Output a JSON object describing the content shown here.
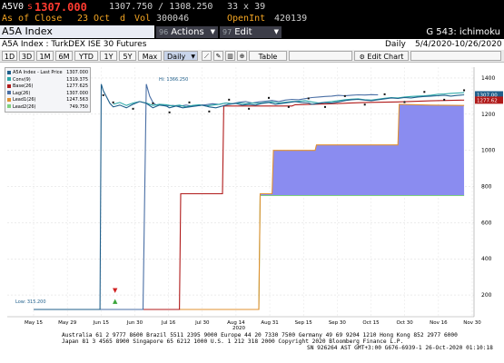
{
  "header": {
    "ticker": "A5V0",
    "last_prefix": "s",
    "last_price": "1307.000",
    "range": "1307.750 / 1308.250",
    "size": "33 x 39",
    "as_of_label": "As of Close",
    "as_of_date": "23 Oct",
    "as_of_flag": "d",
    "vol_label": "Vol",
    "vol_value": "300046",
    "openint_label": "OpenInt",
    "openint_value": "420139"
  },
  "toolbar": {
    "title": "A5A Index",
    "actions_num": "96",
    "actions_label": "Actions",
    "edit_num": "97",
    "edit_label": "Edit",
    "func_label": "G 543: ichimoku"
  },
  "subheader": {
    "security": "A5A Index : TurkDEX ISE 30 Futures",
    "period": "Daily",
    "date_range": "5/4/2020-10/26/2020"
  },
  "tabs": {
    "items": [
      "1D",
      "3D",
      "1M",
      "6M",
      "YTD",
      "1Y",
      "5Y",
      "Max"
    ],
    "frequency": "Daily",
    "table_label": "Table",
    "edit_chart_label": "Edit Chart"
  },
  "legend": {
    "items": [
      {
        "label": "A5A Index - Last Price",
        "value": "1307.000",
        "color": "#1f5f8b"
      },
      {
        "label": "Conv(9)",
        "value": "1319.375",
        "color": "#2aa7a7"
      },
      {
        "label": "Base(26)",
        "value": "1277.625",
        "color": "#b01a1a"
      },
      {
        "label": "Lag(26)",
        "value": "1307.000",
        "color": "#4a6fa5"
      },
      {
        "label": "Lead1(26)",
        "value": "1247.563",
        "color": "#e09030"
      },
      {
        "label": "Lead2(26)",
        "value": "749.750",
        "color": "#7ed07e"
      }
    ]
  },
  "annotations": {
    "high": "Hi: 1366.250",
    "low": "Low: 315.200"
  },
  "chart_data": {
    "type": "line",
    "y_ticks": [
      "1400",
      "1200",
      "1000",
      "800",
      "600",
      "400",
      "200"
    ],
    "ylim": [
      80,
      1460
    ],
    "x_ticks": [
      "May 15",
      "May 29",
      "Jun 15",
      "Jun 30",
      "Jul 16",
      "Jul 30",
      "Aug 14",
      "Aug 31",
      "Sep 15",
      "Sep 30",
      "Oct 15",
      "Oct 30",
      "Nov 16",
      "Nov 30"
    ],
    "x_axis_year": "2020",
    "last_price_tag": "1307.00",
    "base_tag": "1277.62",
    "series": [
      {
        "name": "A5A Index - Last Price",
        "color": "#1f5f8b",
        "x": [
          0,
          20,
          20.4,
          21,
          22,
          23,
          24,
          26,
          28,
          30,
          32,
          34,
          36,
          38,
          40,
          41,
          43,
          45,
          47,
          49,
          51,
          53,
          55,
          57,
          59,
          61,
          63,
          65,
          67,
          69,
          71,
          73,
          75,
          77,
          79,
          81,
          83,
          84,
          86,
          88,
          90,
          92,
          94,
          96,
          98,
          100,
          102,
          104,
          106,
          108,
          110,
          112,
          114,
          116,
          118,
          120,
          122,
          124,
          126,
          128,
          130
        ],
        "y": [
          120,
          120,
          1366,
          1330,
          1295,
          1260,
          1240,
          1250,
          1235,
          1255,
          1270,
          1260,
          1235,
          1250,
          1245,
          1235,
          1245,
          1235,
          1240,
          1245,
          1250,
          1240,
          1235,
          1245,
          1255,
          1260,
          1250,
          1255,
          1250,
          1260,
          1265,
          1255,
          1260,
          1265,
          1270,
          1265,
          1262,
          1255,
          1260,
          1265,
          1262,
          1268,
          1275,
          1280,
          1282,
          1278,
          1275,
          1280,
          1285,
          1290,
          1287,
          1292,
          1290,
          1295,
          1298,
          1300,
          1302,
          1305,
          1300,
          1304,
          1307
        ]
      },
      {
        "name": "Conv(9)",
        "color": "#2aa7a7",
        "x": [
          24,
          26,
          28,
          30,
          32,
          34,
          36,
          38,
          40,
          42,
          44,
          46,
          48,
          50,
          52,
          54,
          56,
          58,
          60,
          62,
          64,
          66,
          68,
          70,
          72,
          74,
          76,
          78,
          80,
          82,
          84,
          86,
          88,
          90,
          92,
          94,
          96,
          98,
          100,
          102,
          104,
          106,
          108,
          110,
          112,
          114,
          116,
          118,
          120,
          122,
          124,
          126,
          128,
          130
        ],
        "y": [
          1255,
          1265,
          1248,
          1262,
          1270,
          1262,
          1248,
          1255,
          1252,
          1245,
          1250,
          1240,
          1248,
          1252,
          1245,
          1250,
          1255,
          1262,
          1258,
          1262,
          1258,
          1262,
          1260,
          1265,
          1268,
          1262,
          1266,
          1270,
          1272,
          1275,
          1268,
          1262,
          1266,
          1270,
          1275,
          1280,
          1283,
          1285,
          1280,
          1278,
          1283,
          1288,
          1292,
          1290,
          1295,
          1298,
          1300,
          1302,
          1305,
          1310,
          1312,
          1315,
          1317,
          1319
        ]
      },
      {
        "name": "Base(26)",
        "color": "#b01a1a",
        "x": [
          0,
          44,
          44.4,
          57,
          57.4,
          78,
          79,
          90,
          100,
          110,
          120,
          130
        ],
        "y": [
          120,
          120,
          760,
          760,
          1245,
          1245,
          1252,
          1258,
          1265,
          1268,
          1274,
          1278
        ]
      },
      {
        "name": "Lag(26)",
        "color": "#4a6fa5",
        "x": [
          0,
          33,
          34,
          35,
          36,
          37,
          38,
          40,
          42,
          44,
          46,
          48,
          50,
          52,
          54,
          56,
          58,
          60,
          62,
          64,
          66,
          68,
          70,
          72,
          74,
          76,
          78,
          80,
          82,
          84,
          86,
          88,
          90,
          92,
          94,
          96,
          98,
          100,
          102,
          104
        ],
        "y": [
          120,
          120,
          1366,
          1300,
          1265,
          1250,
          1255,
          1245,
          1248,
          1244,
          1250,
          1244,
          1248,
          1252,
          1258,
          1254,
          1262,
          1258,
          1266,
          1270,
          1262,
          1268,
          1272,
          1276,
          1270,
          1278,
          1282,
          1280,
          1286,
          1292,
          1295,
          1298,
          1300,
          1304,
          1302,
          1305,
          1307,
          1306,
          1308,
          1307
        ]
      },
      {
        "name": "Lead1(26)",
        "color": "#e09030",
        "x": [
          0,
          68,
          68.4,
          72,
          72.4,
          85,
          85.4,
          110,
          110.4,
          120,
          130
        ],
        "y": [
          120,
          120,
          760,
          760,
          1000,
          1000,
          1030,
          1030,
          1255,
          1250,
          1248
        ]
      },
      {
        "name": "Lead2(26)",
        "color": "#7ed07e",
        "x": [
          0,
          68,
          68.4,
          130
        ],
        "y": [
          120,
          120,
          750,
          750
        ]
      }
    ]
  },
  "footer": {
    "line1": "Australia 61 2 9777 8600 Brazil 5511 2395 9000 Europe 44 20 7330 7500 Germany 49 69 9204 1210 Hong Kong 852 2977 6000",
    "line2": "Japan 81 3 4565 8900         Singapore 65 6212 1000         U.S. 1 212 318 2000         Copyright 2020 Bloomberg Finance L.P.",
    "line3": "SN 926264 AST  GMT+3:00 G676-6939-1 26-Oct-2020 01:10:18"
  },
  "colors": {
    "price_red": "#ff3b30",
    "amber": "#f5a623",
    "cloud_fill": "#8a8cf0",
    "tag_blue": "#1f5f8b",
    "tag_red": "#b01a1a"
  }
}
